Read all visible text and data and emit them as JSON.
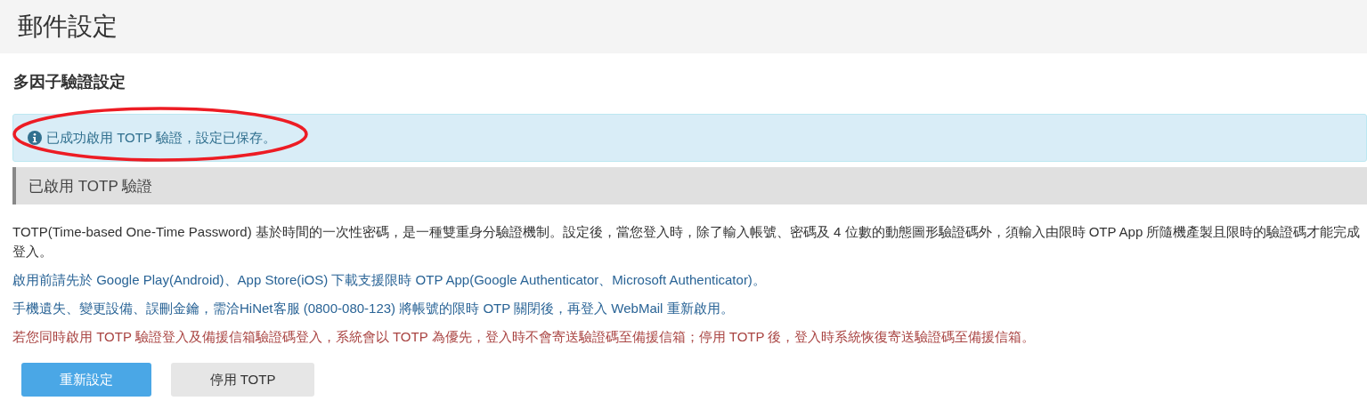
{
  "page_title": "郵件設定",
  "section_title": "多因子驗證設定",
  "alert": {
    "kind": "info",
    "text": "已成功啟用 TOTP 驗證，設定已保存。",
    "highlighted": true
  },
  "panel_heading": "已啟用 TOTP 驗證",
  "paragraphs": [
    {
      "kind": "normal",
      "text": "TOTP(Time-based One-Time Password) 基於時間的一次性密碼，是一種雙重身分驗證機制。設定後，當您登入時，除了輸入帳號、密碼及 4 位數的動態圖形驗證碼外，須輸入由限時 OTP App 所隨機產製且限時的驗證碼才能完成登入。"
    },
    {
      "kind": "info",
      "text": "啟用前請先於 Google Play(Android)、App Store(iOS) 下載支援限時 OTP App(Google Authenticator、Microsoft Authenticator)。"
    },
    {
      "kind": "info",
      "text": "手機遺失、變更設備、誤刪金鑰，需洽HiNet客服 (0800-080-123) 將帳號的限時 OTP 關閉後，再登入 WebMail 重新啟用。"
    },
    {
      "kind": "warning",
      "text": "若您同時啟用 TOTP 驗證登入及備援信箱驗證碼登入，系統會以 TOTP 為優先，登入時不會寄送驗證碼至備援信箱；停用 TOTP 後，登入時系統恢復寄送驗證碼至備援信箱。"
    }
  ],
  "buttons": [
    {
      "kind": "primary",
      "label": "重新設定"
    },
    {
      "kind": "secondary",
      "label": "停用 TOTP"
    }
  ]
}
